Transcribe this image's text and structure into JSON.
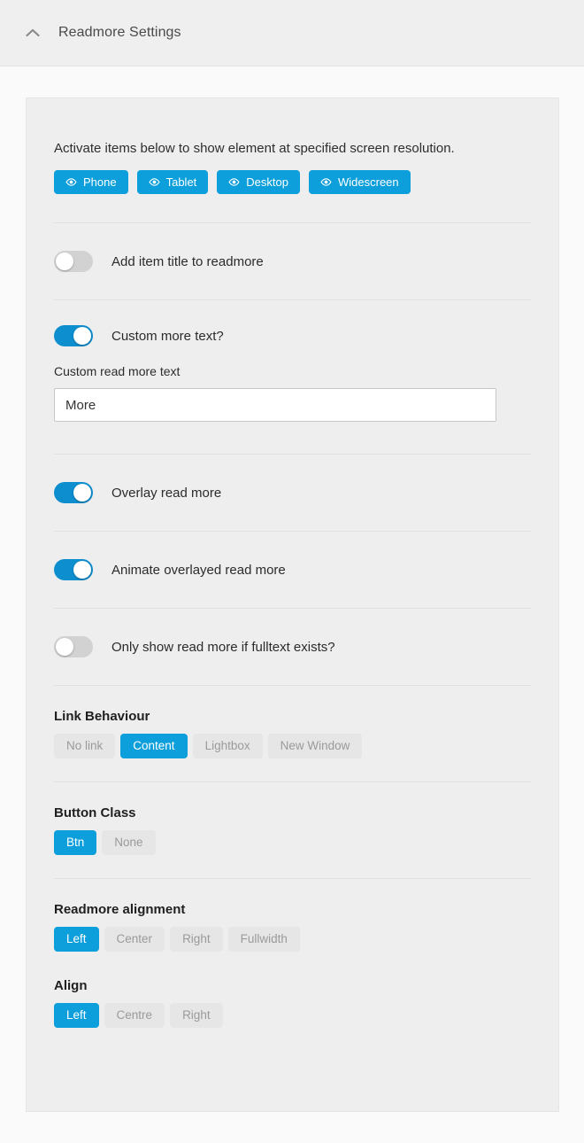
{
  "header": {
    "title": "Readmore Settings",
    "collapse_icon": "chevron-up-icon"
  },
  "panel": {
    "resolution": {
      "description": "Activate items below to show element at specified screen resolution.",
      "icon": "eye-icon",
      "buttons": [
        {
          "label": "Phone",
          "active": true
        },
        {
          "label": "Tablet",
          "active": true
        },
        {
          "label": "Desktop",
          "active": true
        },
        {
          "label": "Widescreen",
          "active": true
        }
      ]
    },
    "toggles": [
      {
        "label": "Add item title to readmore",
        "on": false
      },
      {
        "label": "Custom more text?",
        "on": true
      },
      {
        "label": "Overlay read more",
        "on": true
      },
      {
        "label": "Animate overlayed read more",
        "on": true
      },
      {
        "label": "Only show read more if fulltext exists?",
        "on": false
      }
    ],
    "custom_text_field": {
      "label": "Custom read more text",
      "value": "More",
      "placeholder": ""
    },
    "link_behaviour": {
      "title": "Link Behaviour",
      "options": [
        {
          "label": "No link",
          "active": false
        },
        {
          "label": "Content",
          "active": true
        },
        {
          "label": "Lightbox",
          "active": false
        },
        {
          "label": "New Window",
          "active": false
        }
      ]
    },
    "button_class": {
      "title": "Button Class",
      "options": [
        {
          "label": "Btn",
          "active": true
        },
        {
          "label": "None",
          "active": false
        }
      ]
    },
    "readmore_alignment": {
      "title": "Readmore alignment",
      "options": [
        {
          "label": "Left",
          "active": true
        },
        {
          "label": "Center",
          "active": false
        },
        {
          "label": "Right",
          "active": false
        },
        {
          "label": "Fullwidth",
          "active": false
        }
      ]
    },
    "align": {
      "title": "Align",
      "options": [
        {
          "label": "Left",
          "active": true
        },
        {
          "label": "Centre",
          "active": false
        },
        {
          "label": "Right",
          "active": false
        }
      ]
    }
  },
  "colors": {
    "accent": "#0d9fdb",
    "toggle_on": "#0d8ecf",
    "toggle_off": "#d2d2d2",
    "panel_bg": "#eeeeee",
    "header_bg": "#efefef",
    "page_bg": "#fafafa"
  }
}
